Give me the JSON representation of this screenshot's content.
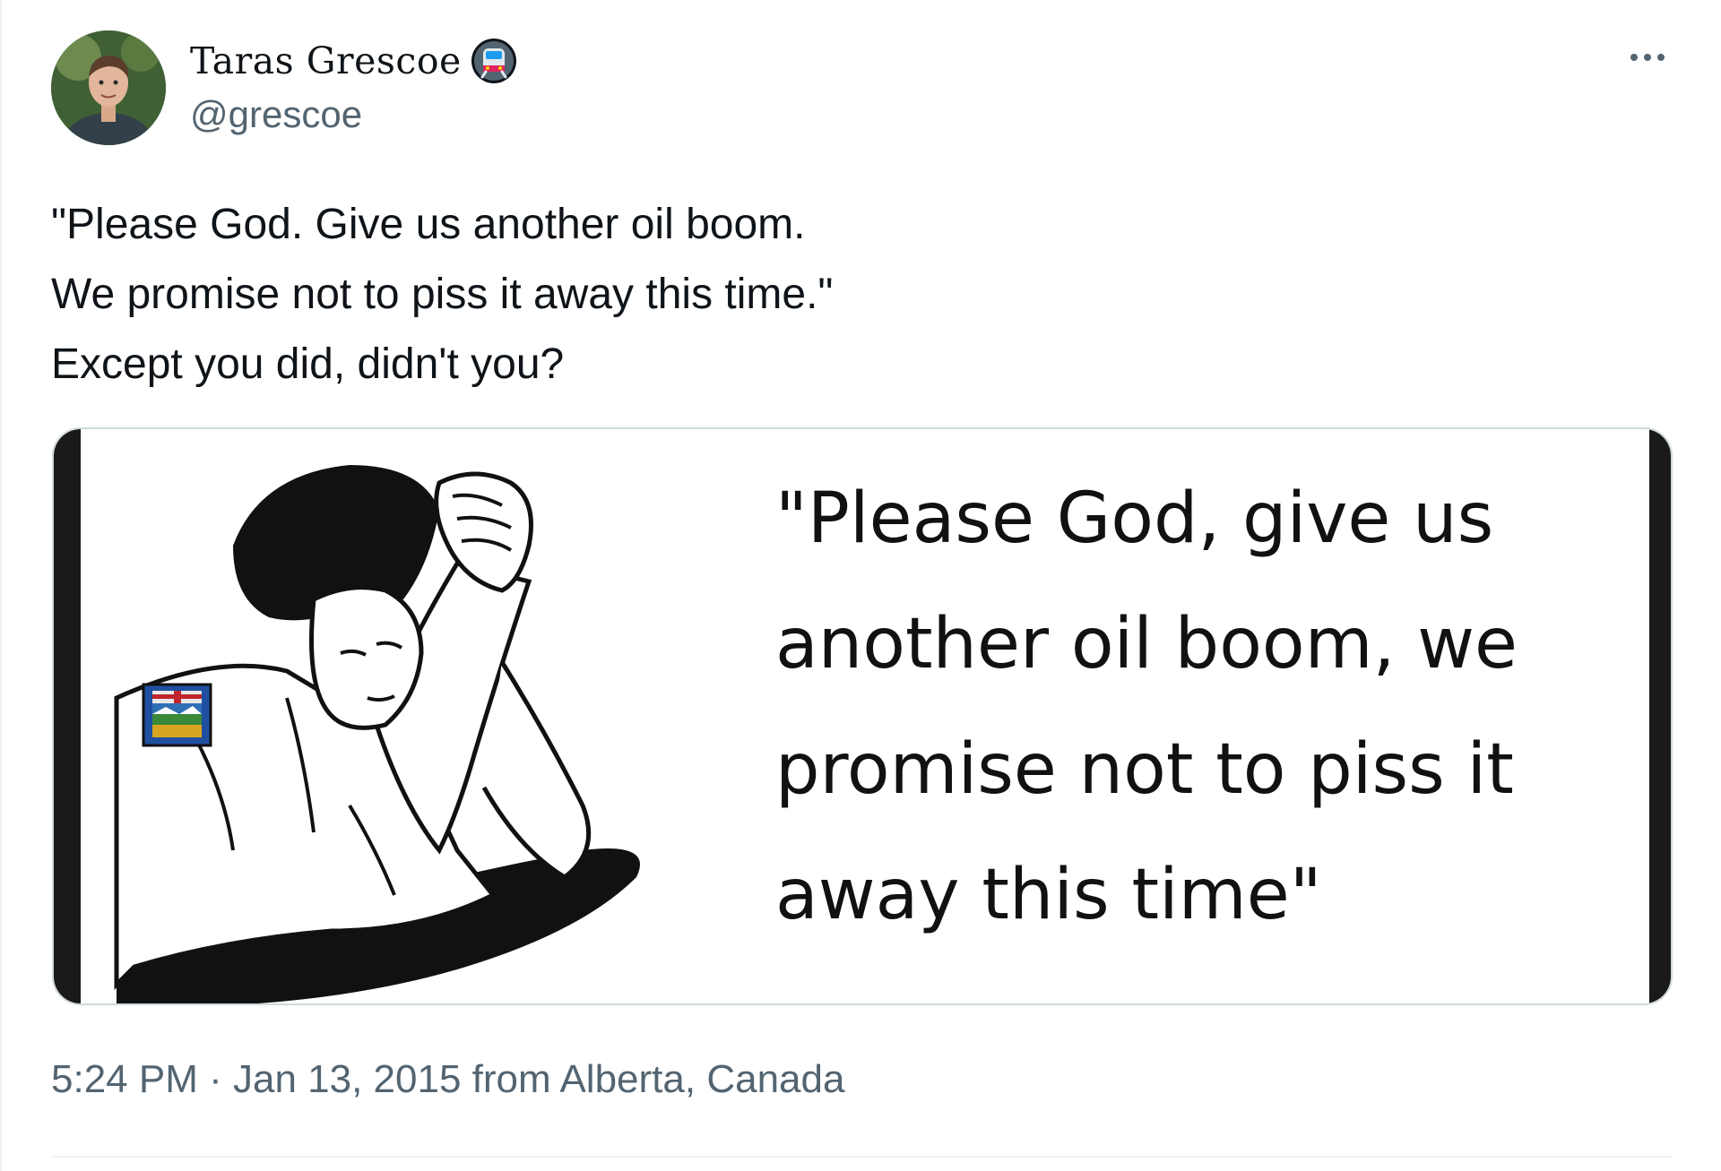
{
  "author": {
    "display_name": "Taras Grescoe",
    "handle": "@grescoe",
    "badge_icon": "train-icon",
    "avatar_icon": "profile-photo"
  },
  "menu": {
    "more_icon": "more-dots-icon"
  },
  "tweet": {
    "lines": [
      "\"Please God. Give us another oil boom.",
      "We promise not to piss it away this time.\"",
      "Except you did, didn't you?"
    ]
  },
  "media": {
    "caption_lines": [
      "\"Please God, give us",
      "another oil boom, we",
      "promise not to piss it",
      "away this time\""
    ]
  },
  "meta": {
    "time": "5:24 PM",
    "separator": " · ",
    "date": "Jan 13, 2015",
    "source": " from Alberta, Canada"
  },
  "colors": {
    "text_primary": "#0f1419",
    "text_secondary": "#536471",
    "border": "#cfd9de"
  }
}
